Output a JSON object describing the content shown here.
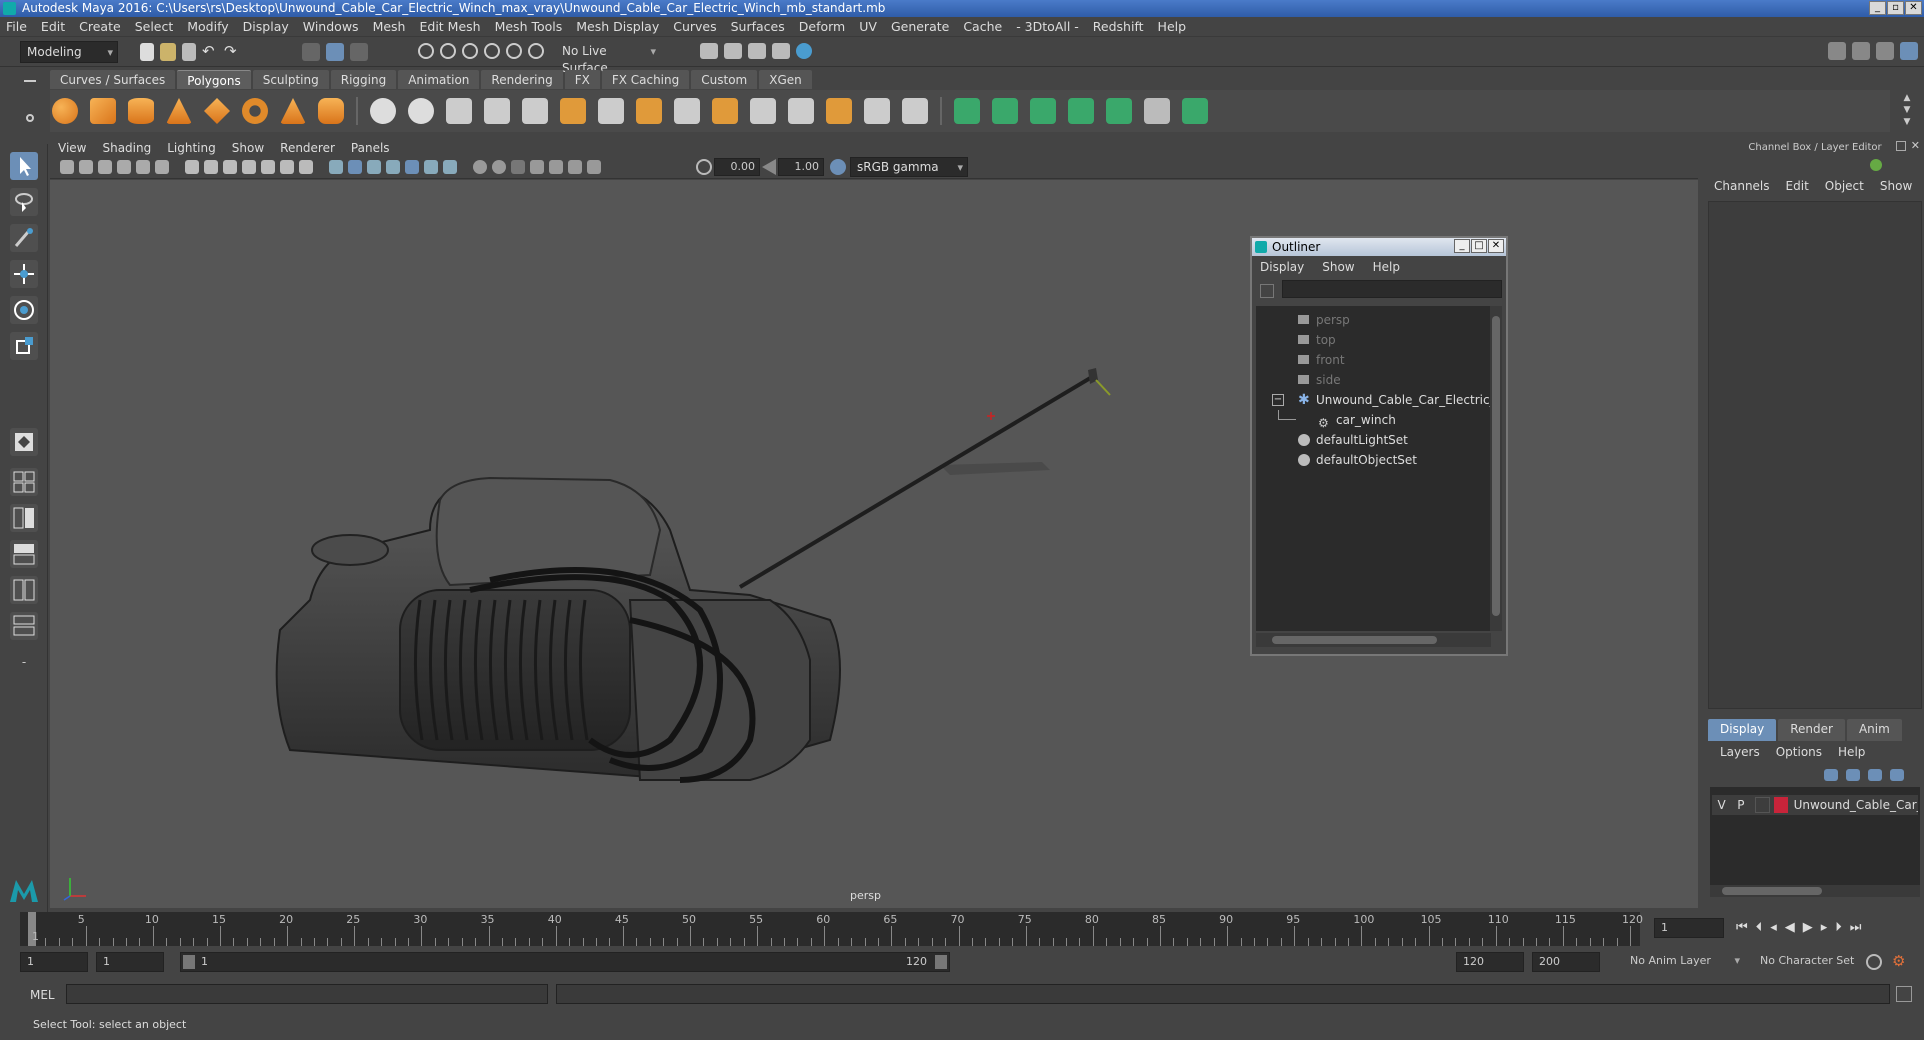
{
  "window": {
    "title": "Autodesk Maya 2016: C:\\Users\\rs\\Desktop\\Unwound_Cable_Car_Electric_Winch_max_vray\\Unwound_Cable_Car_Electric_Winch_mb_standart.mb"
  },
  "menubar": [
    "File",
    "Edit",
    "Create",
    "Select",
    "Modify",
    "Display",
    "Windows",
    "Mesh",
    "Edit Mesh",
    "Mesh Tools",
    "Mesh Display",
    "Curves",
    "Surfaces",
    "Deform",
    "UV",
    "Generate",
    "Cache",
    "- 3DtoAll -",
    "Redshift",
    "Help"
  ],
  "status": {
    "mode": "Modeling",
    "live_surface": "No Live Surface"
  },
  "shelf_tabs": [
    "Curves / Surfaces",
    "Polygons",
    "Sculpting",
    "Rigging",
    "Animation",
    "Rendering",
    "FX",
    "FX Caching",
    "Custom",
    "XGen"
  ],
  "shelf_active": "Polygons",
  "viewport": {
    "menu": [
      "View",
      "Shading",
      "Lighting",
      "Show",
      "Renderer",
      "Panels"
    ],
    "exposure": "0.00",
    "gamma": "1.00",
    "color_space": "sRGB gamma",
    "camera_label": "persp"
  },
  "outliner": {
    "title": "Outliner",
    "menu": [
      "Display",
      "Show",
      "Help"
    ],
    "items": [
      {
        "label": "persp",
        "icon": "camera-icon",
        "dim": true
      },
      {
        "label": "top",
        "icon": "camera-icon",
        "dim": true
      },
      {
        "label": "front",
        "icon": "camera-icon",
        "dim": true
      },
      {
        "label": "side",
        "icon": "camera-icon",
        "dim": true
      },
      {
        "label": "Unwound_Cable_Car_Electric_Wi",
        "icon": "group-icon",
        "dim": false
      },
      {
        "label": "car_winch",
        "icon": "mesh-icon",
        "dim": false
      },
      {
        "label": "defaultLightSet",
        "icon": "set-icon",
        "dim": false
      },
      {
        "label": "defaultObjectSet",
        "icon": "set-icon",
        "dim": false
      }
    ]
  },
  "channel_box": {
    "title": "Channel Box / Layer Editor",
    "tabs": [
      "Channels",
      "Edit",
      "Object",
      "Show"
    ]
  },
  "layer_editor": {
    "tabs": [
      "Display",
      "Render",
      "Anim"
    ],
    "menu": [
      "Layers",
      "Options",
      "Help"
    ],
    "layer": {
      "v": "V",
      "p": "P",
      "name": "Unwound_Cable_Car_",
      "color": "#c8243a"
    }
  },
  "timeline": {
    "ticks": [
      "5",
      "10",
      "15",
      "20",
      "25",
      "30",
      "35",
      "40",
      "45",
      "50",
      "55",
      "60",
      "65",
      "70",
      "75",
      "80",
      "85",
      "90",
      "95",
      "100",
      "105",
      "110",
      "115",
      "120"
    ],
    "start_label": "1",
    "current_frame": "1"
  },
  "range": {
    "start": "1",
    "start2": "1",
    "inner_start": "1",
    "inner_end": "120",
    "end": "120",
    "end2": "200",
    "anim_layer": "No Anim Layer",
    "char_set": "No Character Set"
  },
  "mel": {
    "label": "MEL"
  },
  "help_line": "Select Tool: select an object"
}
